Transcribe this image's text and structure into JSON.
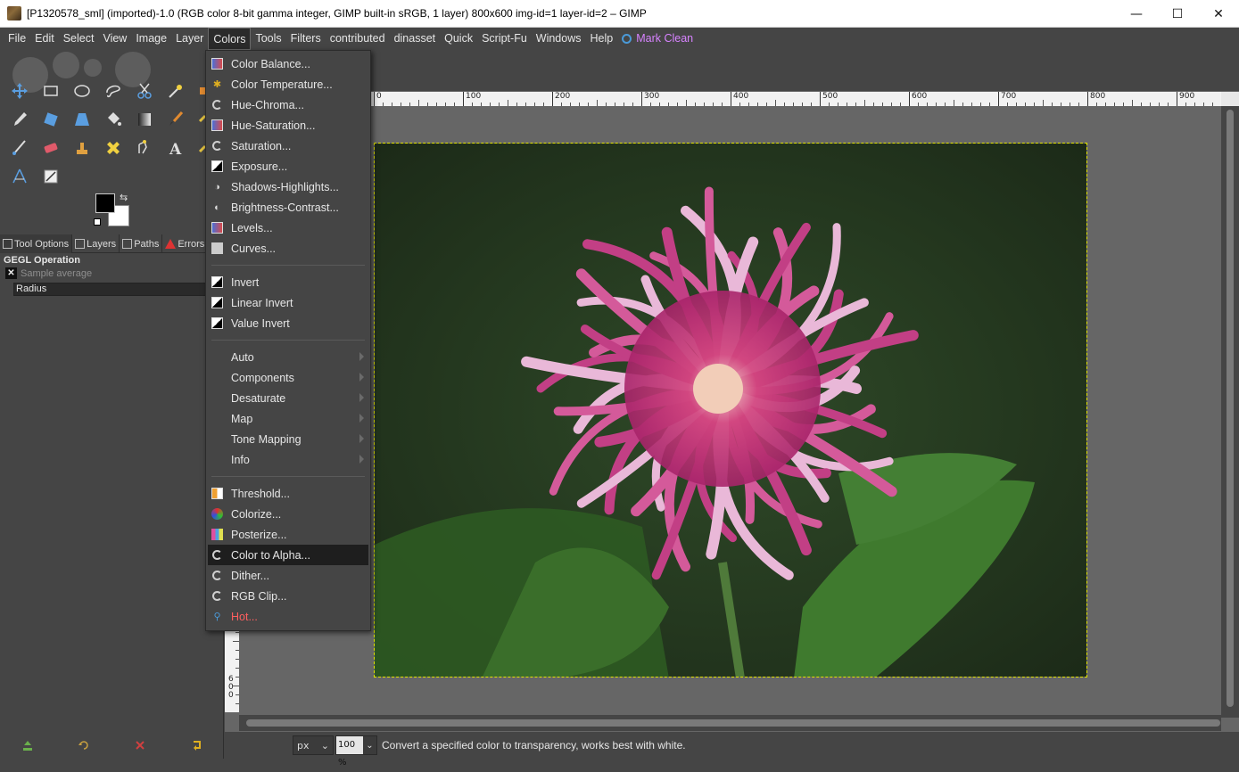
{
  "window": {
    "title": "[P1320578_sml] (imported)-1.0 (RGB color 8-bit gamma integer, GIMP built-in sRGB, 1 layer) 800x600 img-id=1 layer-id=2 – GIMP",
    "minimize": "—",
    "maximize": "☐",
    "close": "✕"
  },
  "menubar": {
    "items": [
      "File",
      "Edit",
      "Select",
      "View",
      "Image",
      "Layer",
      "Colors",
      "Tools",
      "Filters",
      "contributed",
      "dinasset",
      "Quick",
      "Script-Fu",
      "Windows",
      "Help"
    ],
    "active": "Colors",
    "mark_clean": "Mark Clean"
  },
  "dock": {
    "tabs": [
      {
        "label": "Tool Options",
        "icon": "tool-options-icon"
      },
      {
        "label": "Layers",
        "icon": "layers-icon"
      },
      {
        "label": "Paths",
        "icon": "paths-icon"
      },
      {
        "label": "Errors",
        "icon": "error-icon"
      }
    ],
    "tool_options": {
      "title": "GEGL Operation",
      "sample_average": "Sample average",
      "radius": "Radius"
    }
  },
  "colors_menu": {
    "group1": [
      {
        "label": "Color Balance...",
        "icon": "color-balance-icon"
      },
      {
        "label": "Color Temperature...",
        "icon": "color-temperature-icon"
      },
      {
        "label": "Hue-Chroma...",
        "icon": "gegl-icon"
      },
      {
        "label": "Hue-Saturation...",
        "icon": "hue-saturation-icon"
      },
      {
        "label": "Saturation...",
        "icon": "gegl-icon"
      },
      {
        "label": "Exposure...",
        "icon": "exposure-icon"
      },
      {
        "label": "Shadows-Highlights...",
        "icon": "shadows-highlights-icon"
      },
      {
        "label": "Brightness-Contrast...",
        "icon": "brightness-contrast-icon"
      },
      {
        "label": "Levels...",
        "icon": "levels-icon"
      },
      {
        "label": "Curves...",
        "icon": "curves-icon"
      }
    ],
    "group2": [
      {
        "label": "Invert",
        "icon": "invert-icon"
      },
      {
        "label": "Linear Invert",
        "icon": "invert-icon"
      },
      {
        "label": "Value Invert",
        "icon": "invert-icon"
      }
    ],
    "group3": [
      {
        "label": "Auto"
      },
      {
        "label": "Components"
      },
      {
        "label": "Desaturate"
      },
      {
        "label": "Map"
      },
      {
        "label": "Tone Mapping"
      },
      {
        "label": "Info"
      }
    ],
    "group4": [
      {
        "label": "Threshold...",
        "icon": "threshold-icon"
      },
      {
        "label": "Colorize...",
        "icon": "colorize-icon"
      },
      {
        "label": "Posterize...",
        "icon": "posterize-icon"
      },
      {
        "label": "Color to Alpha...",
        "icon": "gegl-icon",
        "highlighted": true
      },
      {
        "label": "Dither...",
        "icon": "gegl-icon"
      },
      {
        "label": "RGB Clip...",
        "icon": "gegl-icon"
      },
      {
        "label": "Hot...",
        "icon": "script-icon",
        "color": "#ff5f5f"
      }
    ]
  },
  "ruler": {
    "top_labels": [
      "0",
      "100",
      "200",
      "300",
      "400",
      "500",
      "600",
      "700",
      "800",
      "900"
    ],
    "left_labels": [
      "6",
      "0",
      "0"
    ]
  },
  "statusbar": {
    "unit": "px",
    "zoom": "100 %",
    "message": "Convert a specified color to transparency, works best with white."
  },
  "colors": {
    "accent_mark_clean": "#d783ff",
    "hot_item": "#ff5f5f",
    "selection_border": "#e4e400",
    "ui_bg": "#454545",
    "canvas_bg": "#666666"
  }
}
